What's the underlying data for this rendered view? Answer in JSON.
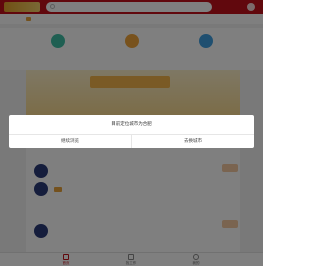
{
  "dialog": {
    "message": "目前定位城市为合肥",
    "switch_label": "继续浏览",
    "confirm_label": "去换城市"
  },
  "tabbar": {
    "items": [
      {
        "label": "首页"
      },
      {
        "label": "找工作"
      },
      {
        "label": "我的"
      }
    ]
  },
  "colors": {
    "brand": "#c2111b",
    "overlay": "rgba(0,0,0,0.5)",
    "banner": "#f8d98f"
  }
}
